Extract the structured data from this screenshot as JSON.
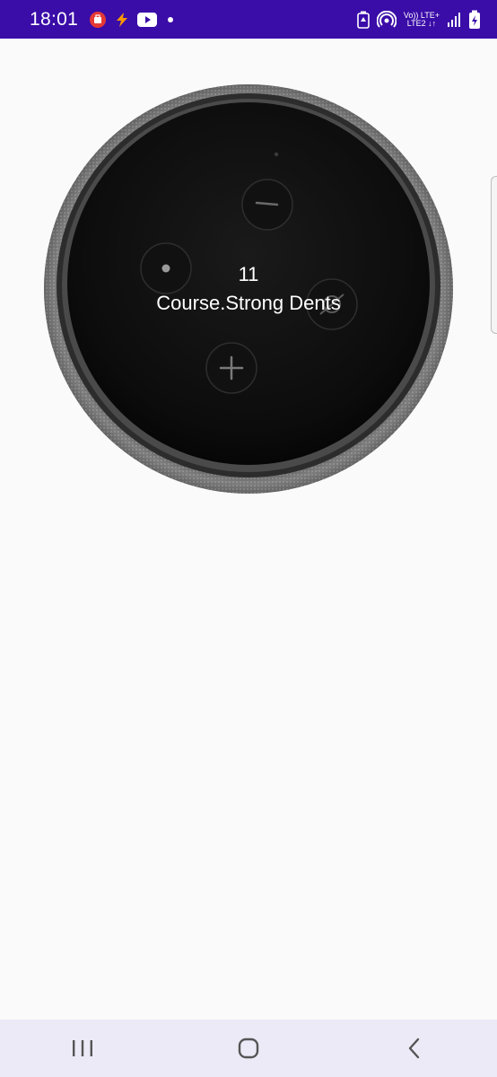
{
  "status_bar": {
    "time": "18:01",
    "volte_label": "Vo)) LTE+\nLTE2 ↓↑",
    "left_icons": [
      "notification-app-icon",
      "flash-icon",
      "youtube-icon",
      "dot-icon"
    ],
    "right_icons": [
      "battery-saver-icon",
      "hotspot-icon",
      "volte-lte-label",
      "signal-icon",
      "battery-charging-icon"
    ],
    "bg_color": "#3a0ca8"
  },
  "speaker": {
    "count": "11",
    "label": "Course.Strong Dents"
  },
  "nav_bar": {
    "buttons": [
      "recents-icon",
      "home-icon",
      "back-icon"
    ],
    "bg_color": "#eceaf7"
  }
}
